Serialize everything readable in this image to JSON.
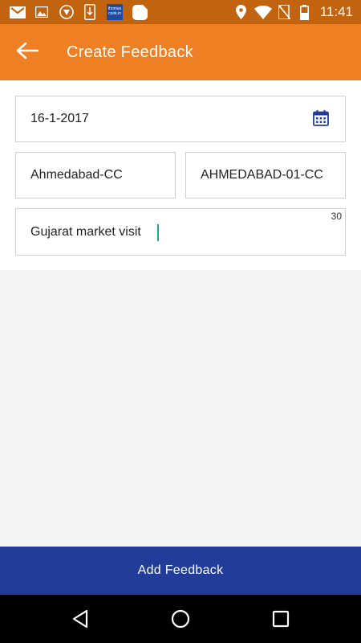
{
  "status_bar": {
    "time": "11:41",
    "icons": [
      "gmail-icon",
      "image-icon",
      "shield-app-icon",
      "download-icon",
      "thomas-cook-icon",
      "chat-icon",
      "location-icon",
      "wifi-icon",
      "no-sim-icon",
      "battery-icon"
    ],
    "app_badge_text": "thomas cook.in"
  },
  "appbar": {
    "title": "Create Feedback",
    "back_icon": "arrow-left-icon"
  },
  "form": {
    "date_value": "16-1-2017",
    "calendar_icon": "calendar-icon",
    "city_value": "Ahmedabad-CC",
    "code_value": "AHMEDABAD-01-CC",
    "remark_value": "Gujarat market visit",
    "char_counter": "30"
  },
  "actions": {
    "add_feedback_label": "Add Feedback"
  },
  "colors": {
    "status_bar": "#c2630f",
    "appbar": "#ee7f22",
    "primary_button": "#213c99",
    "calendar_icon": "#213c99",
    "cursor": "#1ea796"
  }
}
